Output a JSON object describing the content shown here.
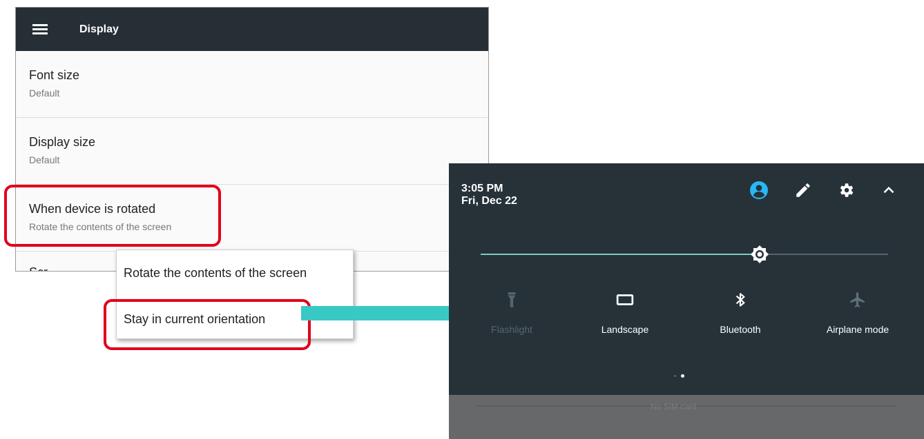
{
  "settings": {
    "title": "Display",
    "items": [
      {
        "title": "Font size",
        "subtitle": "Default"
      },
      {
        "title": "Display size",
        "subtitle": "Default"
      },
      {
        "title": "When device is rotated",
        "subtitle": "Rotate the contents of the screen"
      }
    ],
    "partial_item": "Scr"
  },
  "dropdown": {
    "options": [
      "Rotate the contents of the screen",
      "Stay in current orientation"
    ]
  },
  "quick_settings": {
    "time": "3:05 PM",
    "date": "Fri, Dec 22",
    "header_icons": [
      "account-icon",
      "edit-icon",
      "settings-icon",
      "collapse-icon"
    ],
    "brightness_level": 0.68,
    "tiles": [
      {
        "label": "Flashlight",
        "icon": "flashlight-icon",
        "active": false
      },
      {
        "label": "Landscape",
        "icon": "landscape-icon",
        "active": true
      },
      {
        "label": "Bluetooth",
        "icon": "bluetooth-icon",
        "active": true
      },
      {
        "label": "Airplane mode",
        "icon": "airplane-icon",
        "active": true
      }
    ],
    "bottom_text": "No SIM card"
  },
  "colors": {
    "toolbar": "#262f36",
    "highlight": "#e0001b",
    "arrow": "#39c9c5",
    "accent": "#29b6f6",
    "panel": "#263238"
  }
}
